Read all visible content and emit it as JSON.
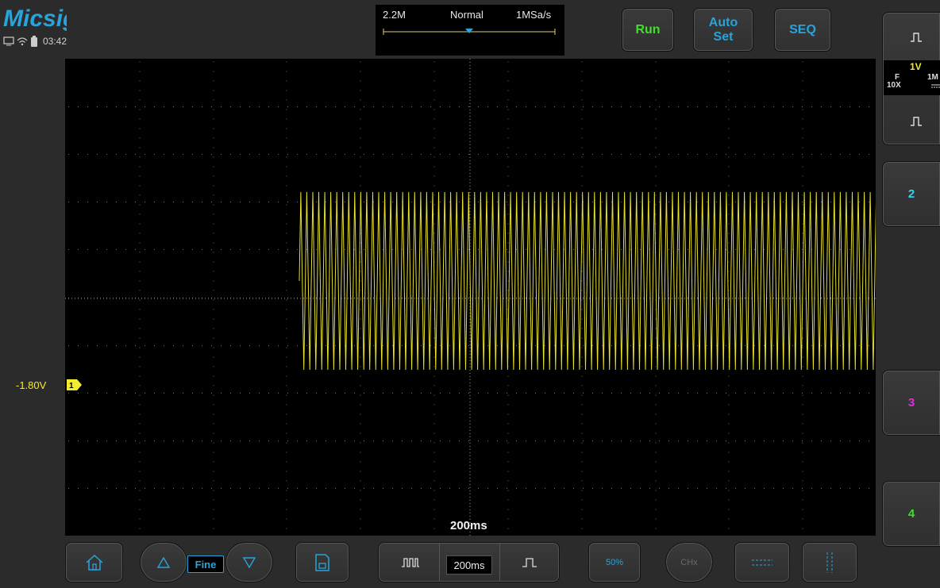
{
  "brand": {
    "name": "Micsig"
  },
  "status": {
    "time": "03:42"
  },
  "acquisition": {
    "memory": "2.2M",
    "mode": "Normal",
    "sample_rate": "1MSa/s"
  },
  "top_buttons": {
    "run": "Run",
    "auto_set": "Auto Set",
    "seq": "SEQ"
  },
  "trigger": {
    "level": "-1.80V",
    "channel_marker": "1"
  },
  "timebase": {
    "display": "200ms",
    "control_value": "200ms"
  },
  "channel1": {
    "scale": "1V",
    "coupling": "F",
    "probe": "10X",
    "impedance": "1M"
  },
  "right_panel": {
    "ch2": "2",
    "ch3": "3",
    "ch4": "4"
  },
  "bottom": {
    "fine_label": "Fine",
    "trigger_50": "50%",
    "chx": "CHx"
  },
  "colors": {
    "ch1": "#f2ec2a",
    "ch2": "#35d3f0",
    "ch3": "#e62ad8",
    "ch4": "#3fe02a",
    "run": "#3fe02a",
    "accent": "#2aa3d9"
  },
  "icons": [
    "display-icon",
    "wifi-icon",
    "battery-icon",
    "square-wave-icon",
    "home-icon",
    "up-triangle-icon",
    "down-triangle-icon",
    "save-icon",
    "pulse-train-icon",
    "cursor-horizontal-icon",
    "cursor-vertical-icon"
  ]
}
